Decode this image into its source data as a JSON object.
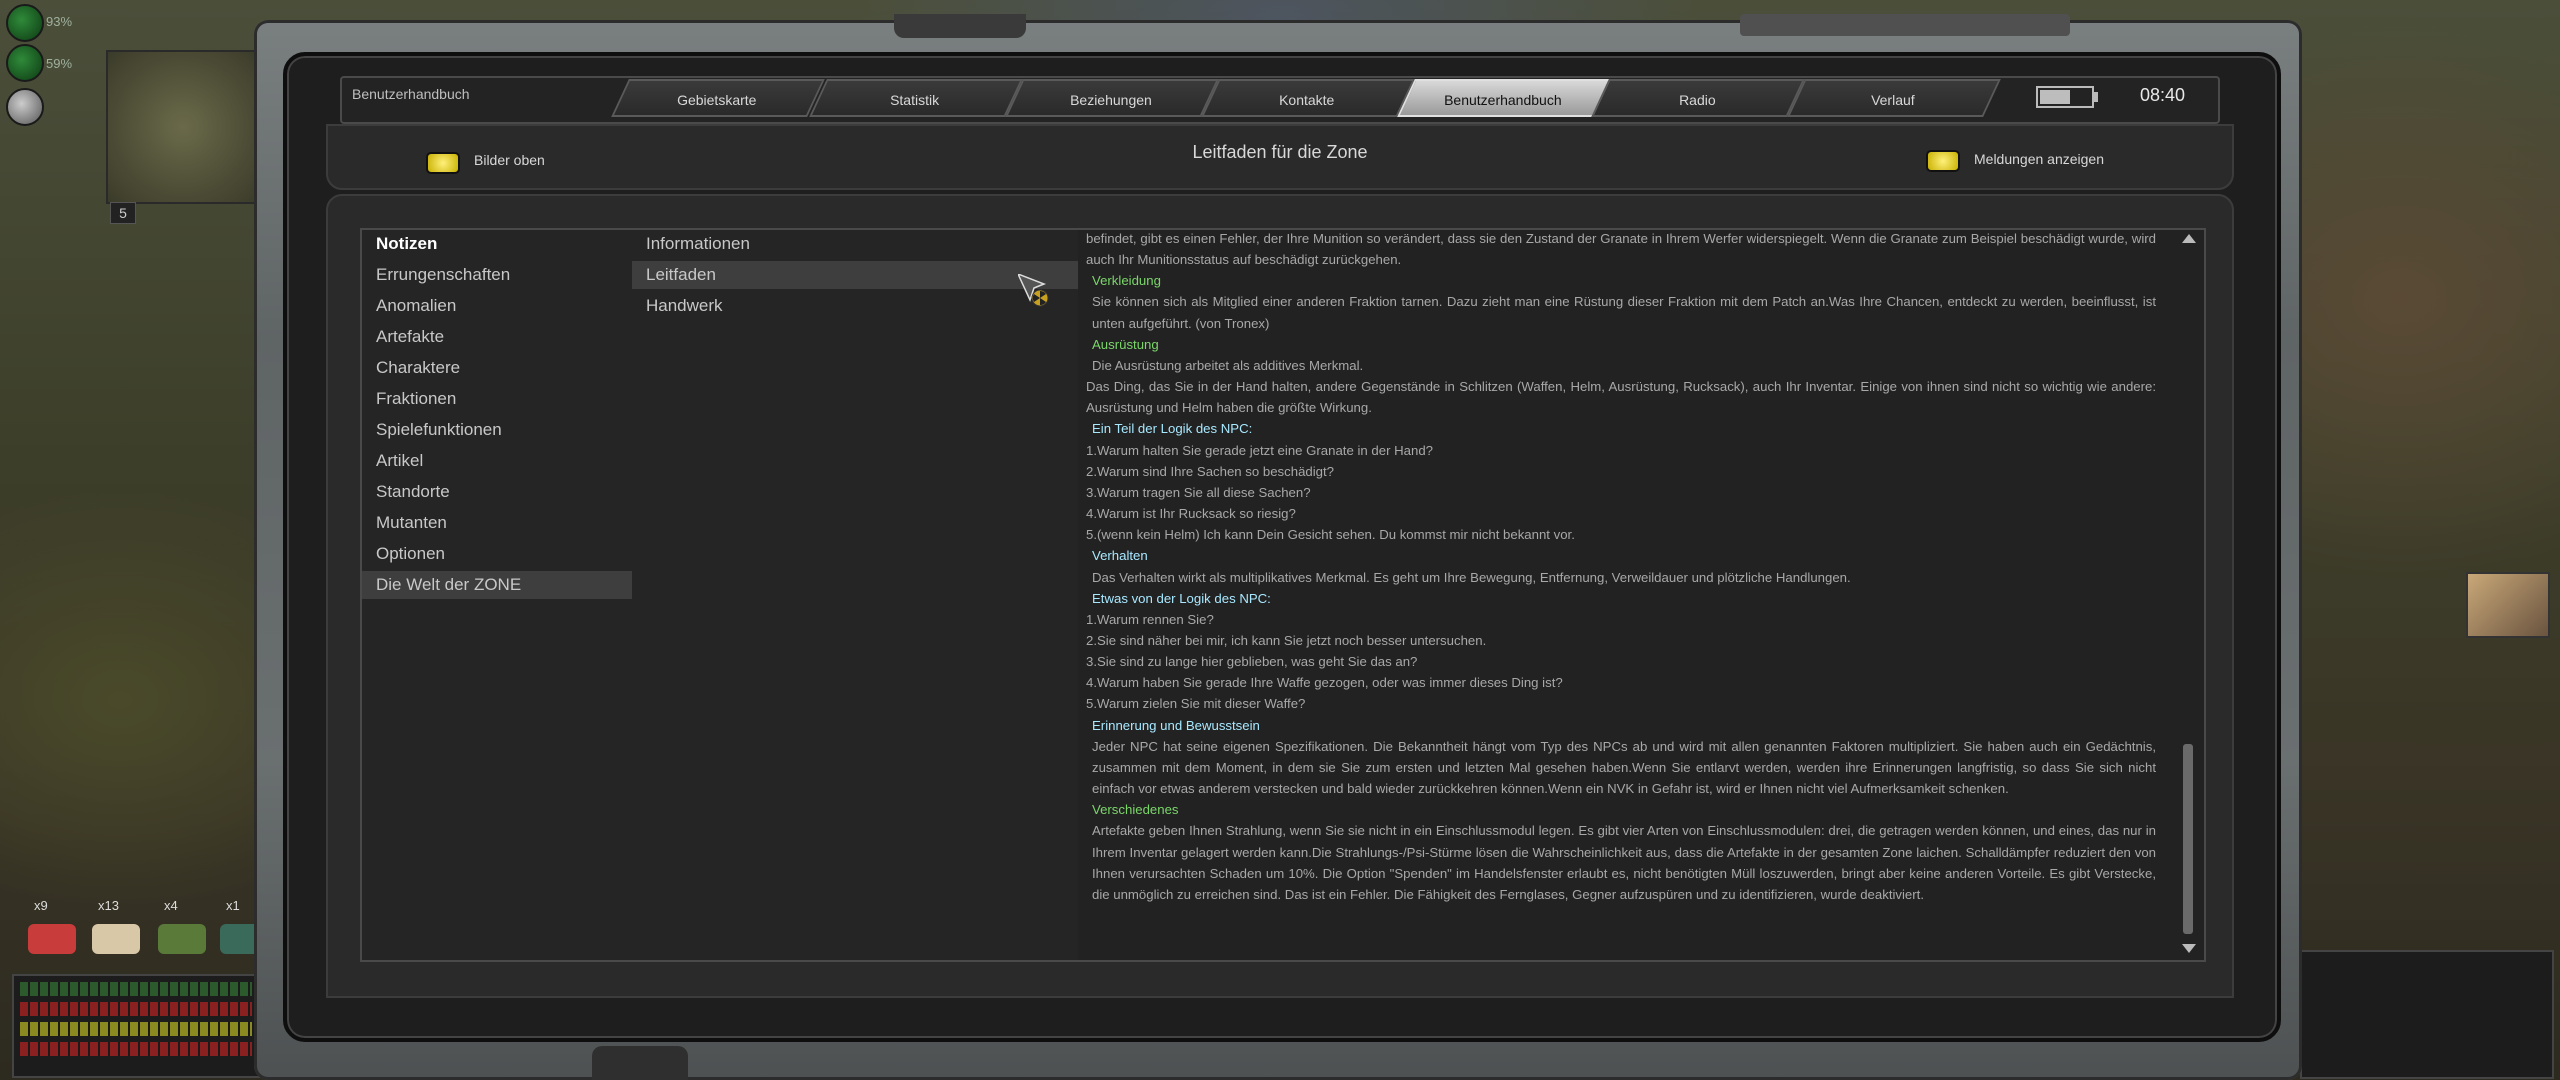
{
  "hud": {
    "stat1_value": "93%",
    "stat2_value": "59%",
    "minimap_level": "5",
    "slots": [
      {
        "count": "x9",
        "color": "#c83c3c"
      },
      {
        "count": "x13",
        "color": "#d8c8a8"
      },
      {
        "count": "x4",
        "color": "#5a7a3a"
      },
      {
        "count": "x1",
        "color": "#3a6a5a"
      }
    ]
  },
  "header": {
    "section_label": "Benutzerhandbuch",
    "tabs": [
      {
        "label": "Gebietskarte"
      },
      {
        "label": "Statistik"
      },
      {
        "label": "Beziehungen"
      },
      {
        "label": "Kontakte"
      },
      {
        "label": "Benutzerhandbuch"
      },
      {
        "label": "Radio"
      },
      {
        "label": "Verlauf"
      }
    ],
    "active_tab": "Benutzerhandbuch",
    "battery_level": 0.6,
    "clock": "08:40"
  },
  "subheader": {
    "left_toggle": "Bilder oben",
    "title": "Leitfaden für die Zone",
    "right_toggle": "Meldungen anzeigen",
    "led_color": "#f0e050"
  },
  "categories": [
    "Notizen",
    "Errungenschaften",
    "Anomalien",
    "Artefakte",
    "Charaktere",
    "Fraktionen",
    "Spielefunktionen",
    "Artikel",
    "Standorte",
    "Mutanten",
    "Optionen",
    "Die Welt der ZONE"
  ],
  "selected_category": "Die Welt der ZONE",
  "subitems": [
    "Informationen",
    "Leitfaden",
    "Handwerk"
  ],
  "selected_subitem": "Leitfaden",
  "article": {
    "p0": "befindet, gibt es einen Fehler, der Ihre Munition so verändert, dass sie den Zustand der Granate in Ihrem Werfer widerspiegelt. Wenn die Granate zum Beispiel beschädigt wurde, wird auch Ihr Munitionsstatus auf beschädigt zurückgehen.",
    "h1": "Verkleidung",
    "p1": "Sie können sich als Mitglied einer anderen Fraktion tarnen. Dazu zieht man eine Rüstung dieser Fraktion mit dem Patch an.Was Ihre Chancen, entdeckt zu werden, beeinflusst, ist unten aufgeführt. (von Tronex)",
    "h2": "Ausrüstung",
    "p2a": "Die Ausrüstung arbeitet als additives Merkmal.",
    "p2b": "Das Ding, das Sie in der Hand halten, andere Gegenstände in Schlitzen (Waffen, Helm, Ausrüstung, Rucksack), auch Ihr Inventar. Einige von ihnen sind nicht so wichtig wie andere: Ausrüstung und Helm haben die größte Wirkung.",
    "h3": "Ein Teil der Logik des NPC:",
    "l3": [
      "1.Warum halten Sie gerade jetzt eine Granate in der Hand?",
      "2.Warum sind Ihre Sachen so beschädigt?",
      "3.Warum tragen Sie all diese Sachen?",
      "4.Warum ist Ihr Rucksack so riesig?",
      "5.(wenn kein Helm) Ich kann Dein Gesicht sehen. Du kommst mir nicht bekannt vor."
    ],
    "h4": "Verhalten",
    "p4": "Das Verhalten wirkt als multiplikatives Merkmal. Es geht um Ihre Bewegung, Entfernung, Verweildauer und plötzliche Handlungen.",
    "h5": "Etwas von der Logik des NPC:",
    "l5": [
      "1.Warum rennen Sie?",
      "2.Sie sind näher bei mir, ich kann Sie jetzt noch besser untersuchen.",
      "3.Sie sind zu lange hier geblieben, was geht Sie das an?",
      "4.Warum haben Sie gerade Ihre Waffe gezogen, oder was immer dieses Ding ist?",
      "5.Warum zielen Sie mit dieser Waffe?"
    ],
    "h6": "Erinnerung und Bewusstsein",
    "p6": "Jeder NPC hat seine eigenen Spezifikationen. Die Bekanntheit hängt vom Typ des NPCs ab und wird mit allen genannten Faktoren multipliziert. Sie haben auch ein Gedächtnis, zusammen mit dem Moment, in dem sie Sie zum ersten und letzten Mal gesehen haben.Wenn Sie entlarvt werden, werden ihre Erinnerungen langfristig, so dass Sie sich nicht einfach vor etwas anderem verstecken und bald wieder zurückkehren können.Wenn ein NVK in Gefahr ist, wird er Ihnen nicht viel Aufmerksamkeit schenken.",
    "h7": "Verschiedenes",
    "p7": "Artefakte geben Ihnen Strahlung, wenn Sie sie nicht in ein Einschlussmodul legen. Es gibt vier Arten von Einschlussmodulen: drei, die getragen werden können, und eines, das nur in Ihrem Inventar gelagert werden kann.Die Strahlungs-/Psi-Stürme lösen die Wahrscheinlichkeit aus, dass die Artefakte in der gesamten Zone laichen. Schalldämpfer reduziert den von Ihnen verursachten Schaden um 10%. Die Option \"Spenden\" im Handelsfenster erlaubt es, nicht benötigten Müll loszuwerden, bringt aber keine anderen Vorteile. Es gibt Verstecke, die unmöglich zu erreichen sind. Das ist ein Fehler. Die Fähigkeit des Fernglases, Gegner aufzuspüren und zu identifizieren, wurde deaktiviert."
  }
}
